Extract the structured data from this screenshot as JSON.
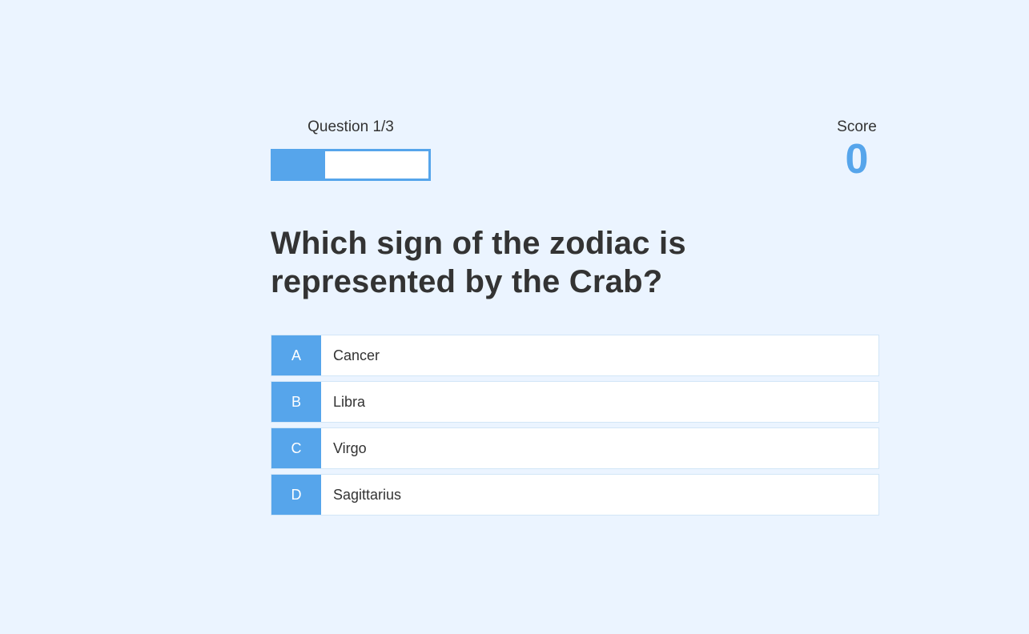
{
  "hud": {
    "progress_text": "Question 1/3",
    "progress_fraction": 0.333,
    "score_label": "Score",
    "score_value": "0"
  },
  "question": "Which sign of the zodiac is represented by the Crab?",
  "choices": [
    {
      "prefix": "A",
      "text": "Cancer"
    },
    {
      "prefix": "B",
      "text": "Libra"
    },
    {
      "prefix": "C",
      "text": "Virgo"
    },
    {
      "prefix": "D",
      "text": "Sagittarius"
    }
  ],
  "colors": {
    "background": "#ebf4ff",
    "accent": "#56a5eb",
    "text": "#333333"
  }
}
